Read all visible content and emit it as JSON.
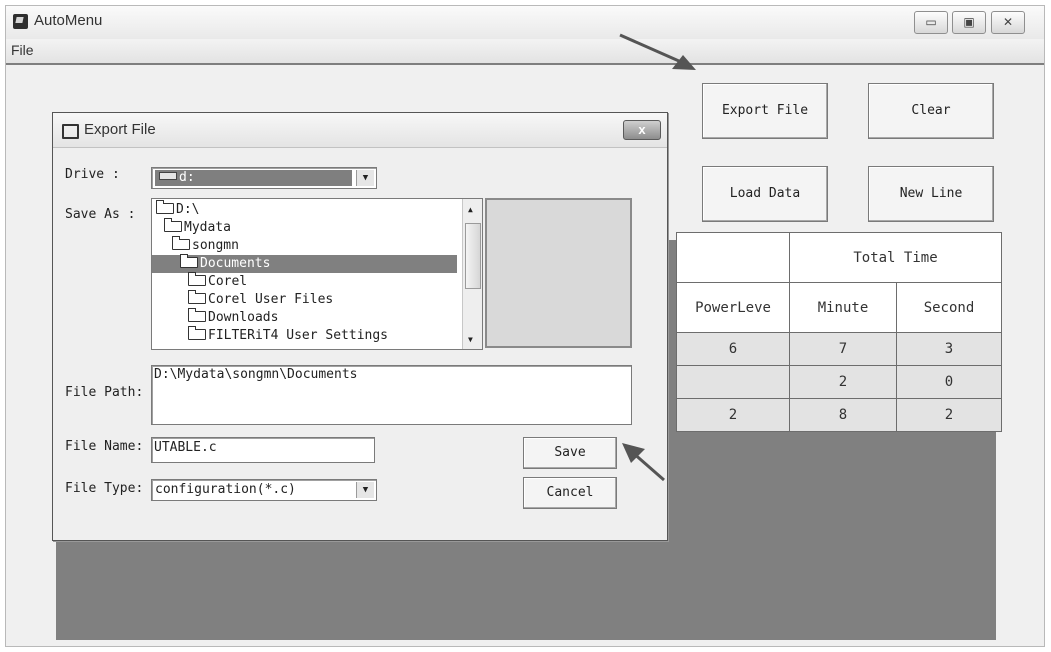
{
  "window": {
    "title": "AutoMenu",
    "minimize_icon": "minimize-icon",
    "maximize_icon": "maximize-icon",
    "close_icon": "close-icon",
    "menu": [
      "File"
    ]
  },
  "toolbar": {
    "export": "Export File",
    "clear": "Clear",
    "load": "Load Data",
    "newline": "New Line"
  },
  "table": {
    "group_header": "Total Time",
    "columns": [
      "PowerLeve",
      "Minute",
      "Second"
    ],
    "rows": [
      [
        "6",
        "7",
        "3"
      ],
      [
        "",
        "2",
        "0"
      ],
      [
        "2",
        "8",
        "2"
      ]
    ]
  },
  "dialog": {
    "title": "Export File",
    "close_label": "x",
    "drive_label": "Drive :",
    "drive_value": "d:",
    "saveas_label": "Save As :",
    "folders": [
      "D:\\",
      "Mydata",
      "songmn",
      "Documents",
      "Corel",
      "Corel User Files",
      "Downloads",
      "FILTERiT4 User Settings"
    ],
    "filepath_label": "File Path:",
    "filepath_value": "D:\\Mydata\\songmn\\Documents",
    "filename_label": "File Name:",
    "filename_value": "UTABLE.c",
    "filetype_label": "File Type:",
    "filetype_value": "configuration(*.c)",
    "save": "Save",
    "cancel": "Cancel"
  },
  "colors": {
    "window_bg": "#f0f0f0",
    "gray_area": "#808080",
    "selection": "#808080",
    "row_bg": "#e3e3e3"
  }
}
